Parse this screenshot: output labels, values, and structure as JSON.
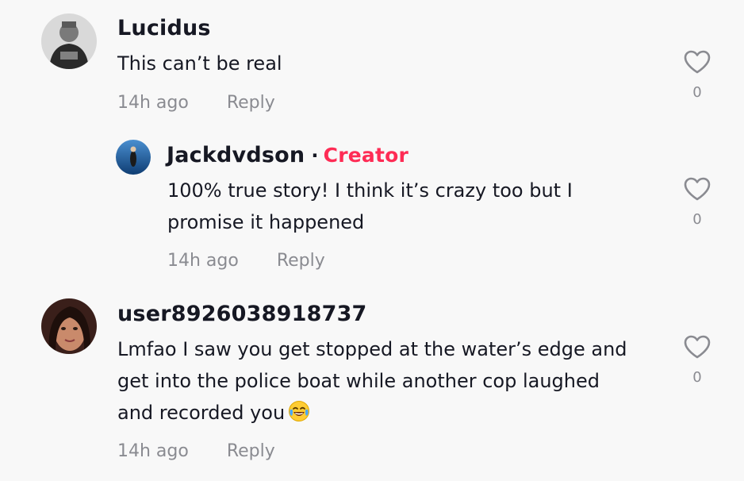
{
  "comments": [
    {
      "username": "Lucidus",
      "text": "This can’t be real",
      "time": "14h ago",
      "reply_label": "Reply",
      "likes": "0"
    },
    {
      "username": "Jackdvdson",
      "badge_separator": "·",
      "badge": "Creator",
      "text_line1": "100% true story! I think it’s crazy too but I",
      "text_line2": "promise it happened",
      "time": "14h ago",
      "reply_label": "Reply",
      "likes": "0"
    },
    {
      "username": "user8926038918737",
      "text_line1": "Lmfao I saw you get stopped at the water’s edge and",
      "text_line2": "get into the police boat while another cop laughed",
      "text_line3": "and recorded you",
      "emoji": "face-with-tears-of-joy",
      "time": "14h ago",
      "reply_label": "Reply",
      "likes": "0"
    }
  ],
  "colors": {
    "background": "#f8f8f8",
    "text": "#161823",
    "muted": "#8a8b91",
    "creator": "#fe2c55"
  },
  "icons": {
    "like": "heart-outline-icon"
  }
}
